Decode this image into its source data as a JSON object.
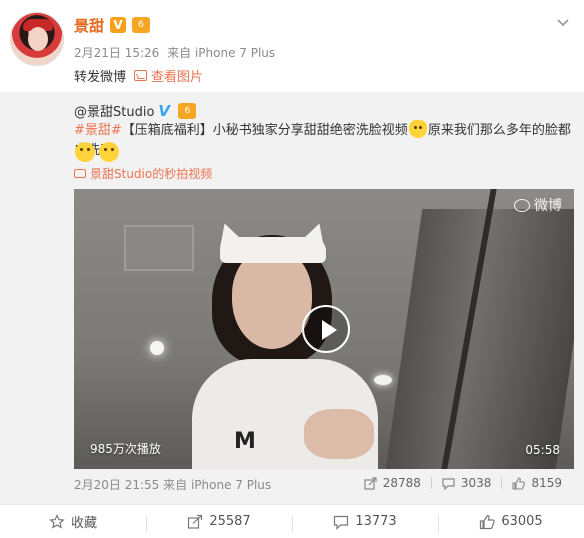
{
  "post": {
    "author": "景甜",
    "vip_mark": "V",
    "level_mark": "6",
    "time": "2月21日 15:26",
    "source": "来自 iPhone 7 Plus",
    "text": "转发微博",
    "view_pic_label": "查看图片"
  },
  "repost": {
    "author": "@景甜Studio",
    "hashtag": "#景甜#",
    "body_a": "【压箱底福利】小秘书独家分享甜甜绝密洗脸视频",
    "body_b": "原来我们那么多年的脸都白洗了",
    "video_link": "景甜Studio的秒拍视频",
    "time": "2月20日 21:55",
    "source": "来自 iPhone 7 Plus",
    "reposts": "28788",
    "comments": "3038",
    "likes": "8159",
    "video": {
      "watermark": "微博",
      "plays": "985万次播放",
      "duration": "05:58",
      "shirt_text": "M"
    }
  },
  "actions": {
    "favorite": "收藏",
    "repost": "25587",
    "comment": "13773",
    "like": "63005"
  },
  "colors": {
    "author_name": "#e3691b",
    "link": "#eb7350",
    "verified_blue": "#36a5ef",
    "repost_bg": "#f2f2f2"
  }
}
